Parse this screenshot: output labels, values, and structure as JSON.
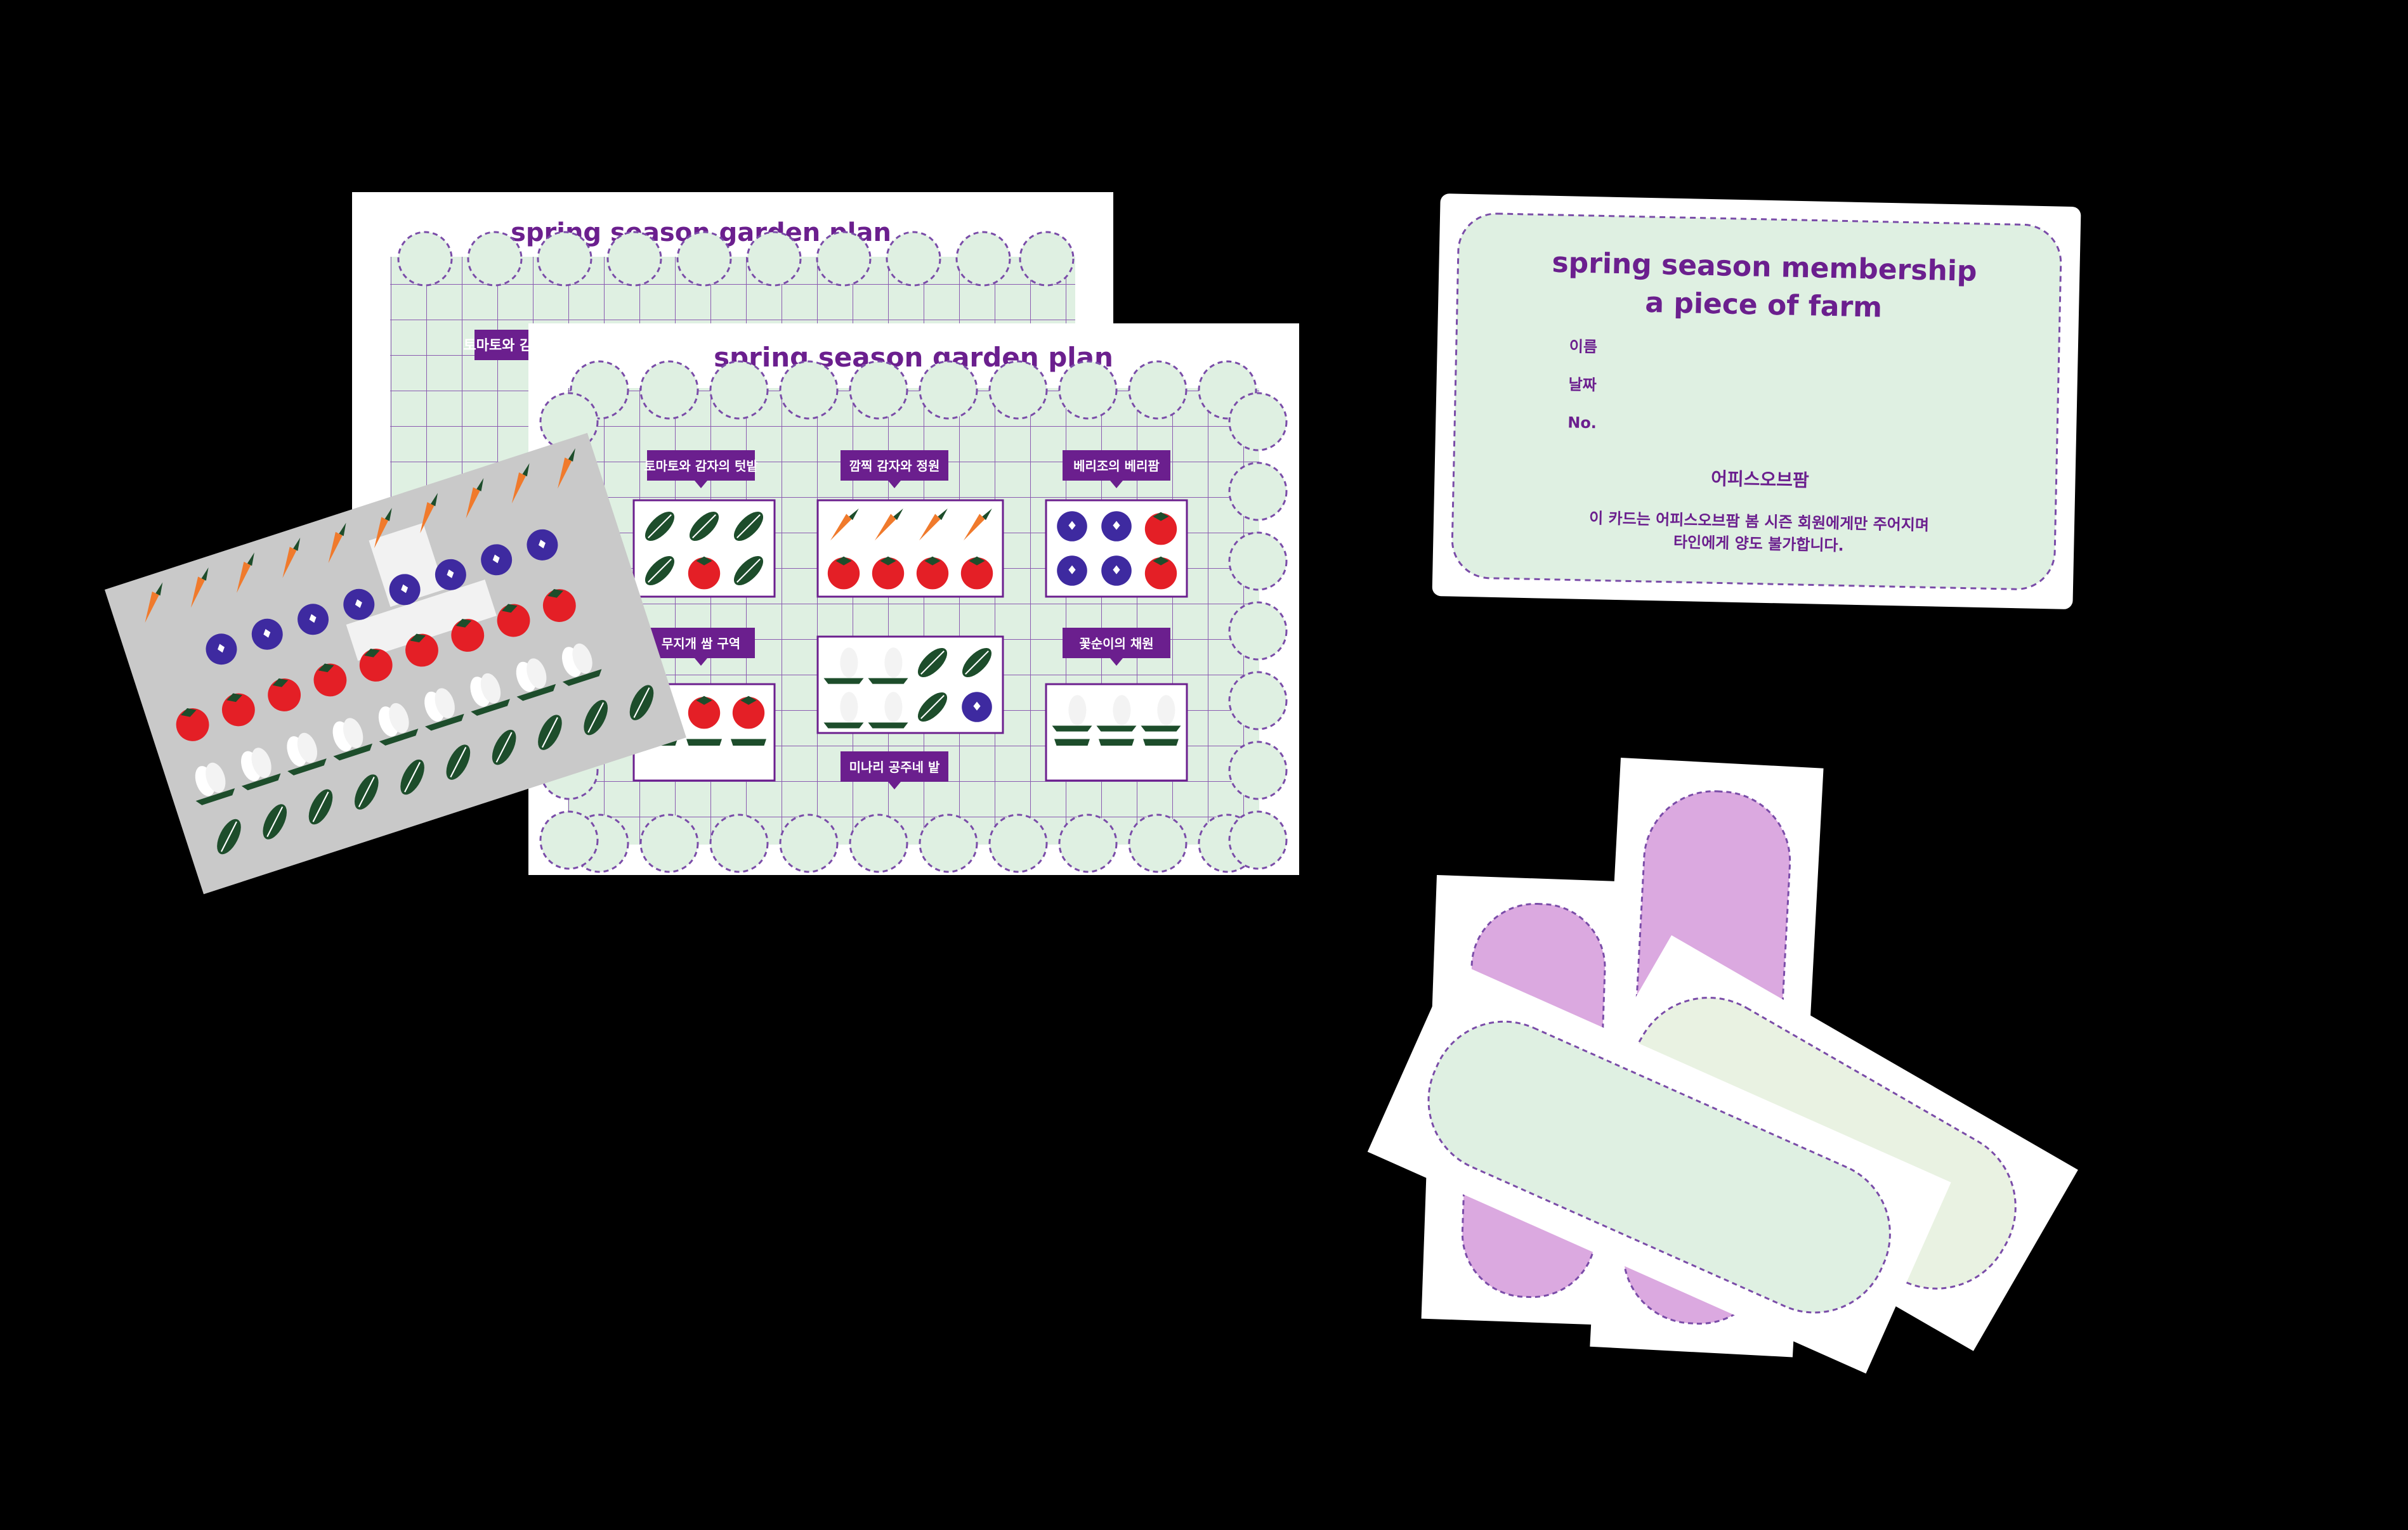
{
  "garden_plan_back": {
    "title": "spring season garden plan",
    "visible_label": "토마토와 감자"
  },
  "garden_plan_front": {
    "title": "spring season garden plan",
    "plots": [
      {
        "label": "토마토와 감자의 텃밭",
        "veg_rows": [
          [
            "leaf",
            "leaf",
            "leaf"
          ],
          [
            "leaf",
            "tomato",
            "leaf"
          ]
        ]
      },
      {
        "label": "깜찍 감자와 정원",
        "veg_rows": [
          [
            "carrot",
            "carrot",
            "carrot",
            "carrot"
          ],
          [
            "tomato",
            "tomato",
            "tomato",
            "tomato"
          ]
        ]
      },
      {
        "label": "베리조의 베리팜",
        "veg_rows": [
          [
            "berry",
            "berry",
            "tomato"
          ],
          [
            "berry",
            "berry",
            "tomato"
          ]
        ]
      },
      {
        "label": "무지개 쌈 구역",
        "veg_rows": [
          [
            "tomato",
            "tomato",
            "tomato"
          ],
          [
            "radish",
            "radish",
            "radish"
          ]
        ]
      },
      {
        "label": "미나리 공주네 밭",
        "veg_rows": [
          [
            "cabbage",
            "cabbage",
            "leaf",
            "leaf"
          ],
          [
            "cabbage",
            "cabbage",
            "leaf",
            "berry"
          ]
        ]
      },
      {
        "label": "꽃순이의 채원",
        "veg_rows": [
          [
            "cabbage",
            "cabbage",
            "cabbage"
          ],
          [
            "radish",
            "radish",
            "radish"
          ]
        ]
      }
    ]
  },
  "sticker_sheet": {
    "rows": [
      [
        "carrot",
        "carrot",
        "carrot",
        "carrot",
        "carrot",
        "carrot",
        "carrot",
        "carrot",
        "carrot",
        "carrot"
      ],
      [
        "berry",
        "berry",
        "berry",
        "berry",
        "berry",
        "berry",
        "berry",
        "berry"
      ],
      [
        "tomato",
        "tomato",
        "tomato",
        "tomato",
        "tomato",
        "tomato",
        "tomato",
        "tomato",
        "tomato"
      ],
      [
        "cabbage",
        "cabbage",
        "cabbage",
        "cabbage",
        "cabbage",
        "cabbage",
        "cabbage",
        "cabbage",
        "cabbage"
      ],
      [
        "leaf",
        "leaf",
        "leaf",
        "leaf",
        "leaf",
        "leaf",
        "leaf",
        "leaf",
        "leaf",
        "leaf"
      ]
    ]
  },
  "membership_card": {
    "title_line1": "spring season membership",
    "title_line2": "a piece of farm",
    "field_name": "이름",
    "field_date": "날짜",
    "field_no": "No.",
    "brand": "어피스오브팜",
    "notice_line1": "이 카드는 어피스오브팜 봄 시즌 회원에게만 주어지며",
    "notice_line2": "타인에게 양도 불가합니다."
  },
  "tags": [
    {
      "color": "#dba9e0"
    },
    {
      "color": "#dba9e0"
    },
    {
      "color": "#e9f2e2"
    },
    {
      "color": "#dff0e2"
    }
  ],
  "colors": {
    "background": "#000000",
    "paper": "#ffffff",
    "mint": "#dff0e2",
    "purple": "#6b1f8e",
    "pink": "#dba9e0",
    "tomato": "#e41f26",
    "leaf": "#1d4d2b",
    "berry": "#3e2aa0",
    "carrot": "#f07a2c",
    "sticker_paper": "#c9c9c9"
  }
}
